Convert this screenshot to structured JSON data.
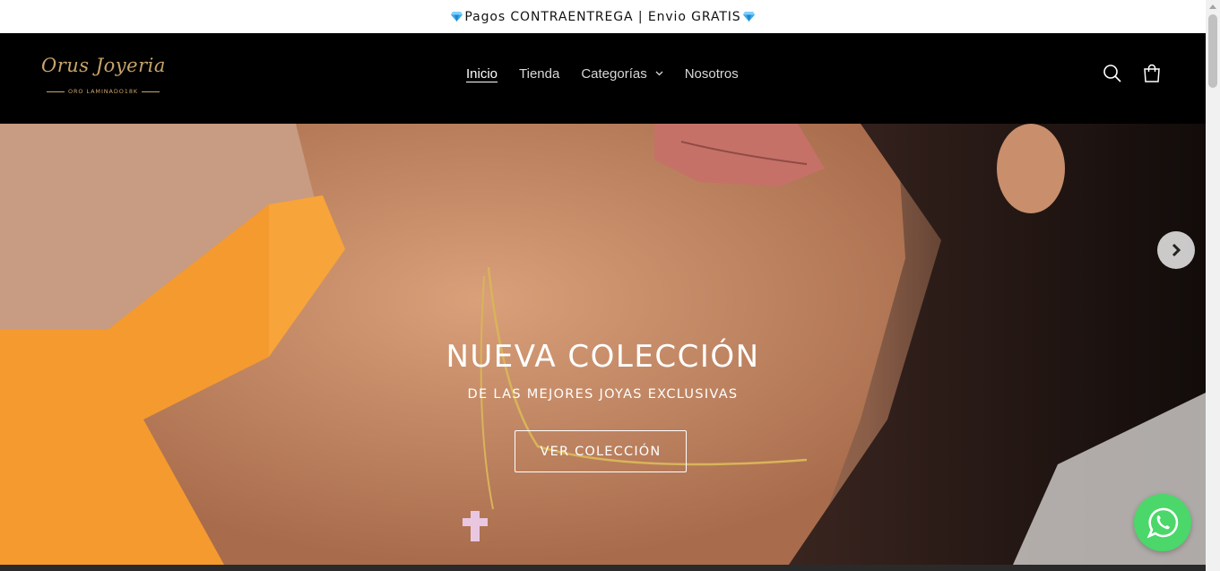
{
  "announcement": {
    "text": "Pagos CONTRAENTREGA | Envio GRATIS",
    "gem_icon": "gem-icon",
    "gem_color": "#3aa8e8"
  },
  "header": {
    "logo": {
      "script": "Orus Joyeria",
      "tagline": "ORO LAMINADO18K",
      "color": "#c9a46a"
    },
    "nav": [
      {
        "label": "Inicio",
        "active": true
      },
      {
        "label": "Tienda"
      },
      {
        "label": "Categorías",
        "has_dropdown": true
      },
      {
        "label": "Nosotros"
      }
    ],
    "icons": [
      "search-icon",
      "cart-icon"
    ],
    "background": "#000000"
  },
  "hero": {
    "title": "NUEVA COLECCIÓN",
    "subtitle": "DE LAS MEJORES JOYAS EXCLUSIVAS",
    "button": "VER COLECCIÓN",
    "next_icon": "chevron-right-icon"
  },
  "floating": {
    "whatsapp_icon": "whatsapp-icon",
    "color": "#4bd76a"
  }
}
